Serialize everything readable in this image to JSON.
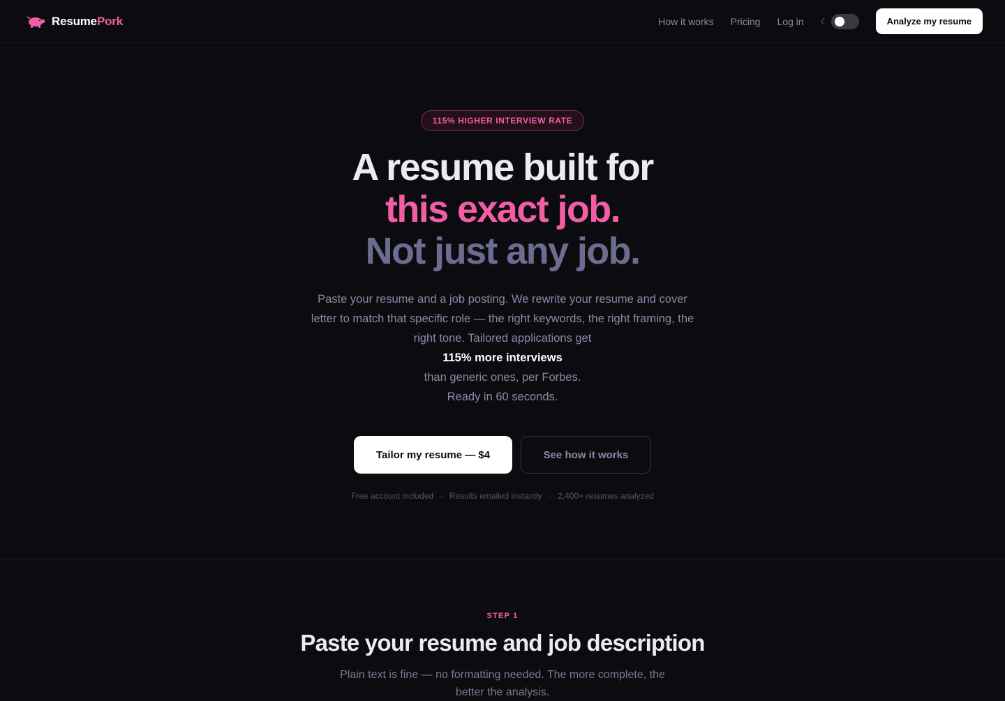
{
  "header": {
    "brand_part1": "Resume",
    "brand_part2": "Pork",
    "logo_icon": "pig-icon",
    "nav": [
      "How it works",
      "Pricing",
      "Log in"
    ],
    "theme_icon": "moon-icon",
    "theme_toggle_on": false,
    "cta_label": "Analyze my resume"
  },
  "hero": {
    "badge": "115% HIGHER INTERVIEW RATE",
    "headline_1": "A resume built for",
    "headline_2": "this exact job.",
    "headline_3": "Not just any job.",
    "sub_1": "Paste your resume and a job posting. We rewrite your resume and cover letter to match that specific role — the right keywords, the right framing, the right tone. Tailored applications get",
    "sub_strong": "115% more interviews",
    "sub_2": "than generic ones, per Forbes.",
    "sub_3": "Ready in 60 seconds.",
    "primary_cta": "Tailor my resume — $4",
    "secondary_cta": "See how it works",
    "trust": [
      "Free account included",
      "Results emailed instantly",
      "2,400+ resumes analyzed"
    ],
    "trust_separator": "·"
  },
  "step1": {
    "label": "STEP 1",
    "title": "Paste your resume and job description",
    "description": "Plain text is fine — no formatting needed. The more complete, the better the analysis."
  },
  "colors": {
    "background": "#0c0b10",
    "accent": "#f25ea6",
    "muted_text": "#8a8ba6",
    "headline_muted": "#6c6c90"
  }
}
